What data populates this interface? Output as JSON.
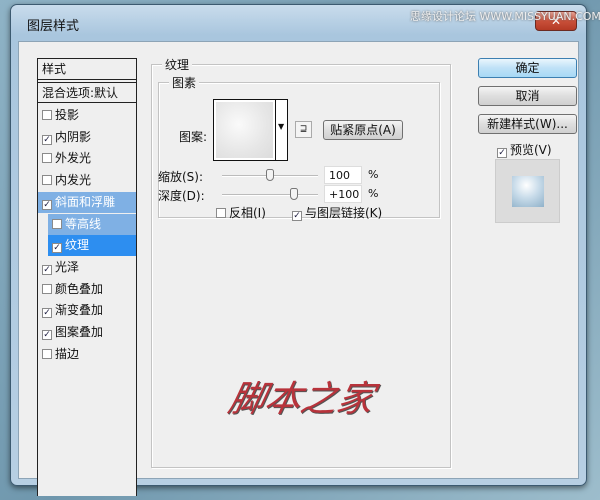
{
  "window": {
    "title": "图层样式",
    "close_label": "✕",
    "watermark_top": "思缘设计论坛 WWW.MISSYUAN.COM"
  },
  "styles_list": {
    "header": "样式",
    "blend": "混合选项:默认",
    "items": [
      {
        "label": "投影",
        "checked": false
      },
      {
        "label": "内阴影",
        "checked": true
      },
      {
        "label": "外发光",
        "checked": false
      },
      {
        "label": "内发光",
        "checked": false
      },
      {
        "label": "斜面和浮雕",
        "checked": true,
        "state": "group-highlight"
      },
      {
        "label": "等高线",
        "checked": false,
        "state": "sub-highlight"
      },
      {
        "label": "纹理",
        "checked": true,
        "state": "selected"
      },
      {
        "label": "光泽",
        "checked": true
      },
      {
        "label": "颜色叠加",
        "checked": false
      },
      {
        "label": "渐变叠加",
        "checked": true
      },
      {
        "label": "图案叠加",
        "checked": true
      },
      {
        "label": "描边",
        "checked": false
      }
    ]
  },
  "texture": {
    "section_title": "纹理",
    "group_title": "图素",
    "pattern_label": "图案:",
    "snap_button": "贴紧原点(A)",
    "scale_label": "缩放(S):",
    "scale_value": "100",
    "scale_unit": "%",
    "scale_fraction": 0.5,
    "depth_label": "深度(D):",
    "depth_value": "+100",
    "depth_unit": "%",
    "depth_fraction": 0.75,
    "invert_label": "反相(I)",
    "invert_checked": false,
    "link_label": "与图层链接(K)",
    "link_checked": true
  },
  "buttons": {
    "ok": "确定",
    "cancel": "取消",
    "new_style": "新建样式(W)...",
    "preview_label": "预览(V)",
    "preview_checked": true
  },
  "watermark": "脚本之家",
  "colors": {
    "selected": "#2d8ef0",
    "group_highlight": "#7fb0e4",
    "watermark": "#b8333b"
  }
}
